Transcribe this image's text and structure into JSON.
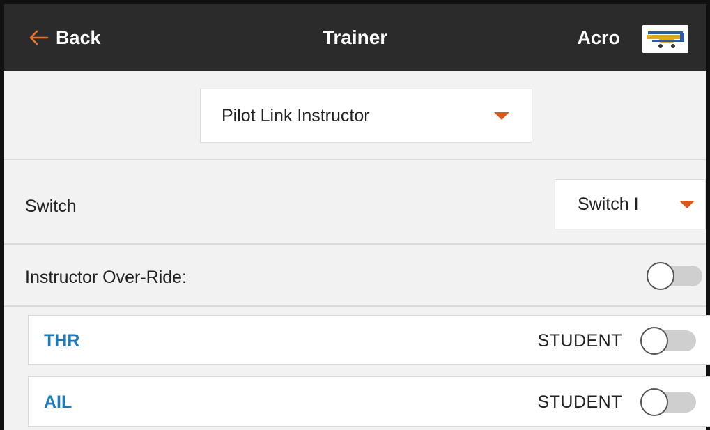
{
  "header": {
    "back_label": "Back",
    "title": "Trainer",
    "model_name": "Acro",
    "model_image": "airplane-thumbnail"
  },
  "trainer_mode": {
    "selected": "Pilot Link Instructor"
  },
  "switch_row": {
    "label": "Switch",
    "selected": "Switch I"
  },
  "override_row": {
    "label": "Instructor Over-Ride:",
    "enabled": false
  },
  "channels": [
    {
      "name": "THR",
      "mode": "STUDENT",
      "enabled": false
    },
    {
      "name": "AIL",
      "mode": "STUDENT",
      "enabled": false
    }
  ],
  "colors": {
    "header_bg": "#2b2b2b",
    "accent_orange": "#d9591c",
    "channel_blue": "#1f7ab8",
    "background": "#f2f2f2"
  },
  "icons": {
    "back": "arrow-left-icon",
    "dropdown": "caret-down-icon"
  }
}
